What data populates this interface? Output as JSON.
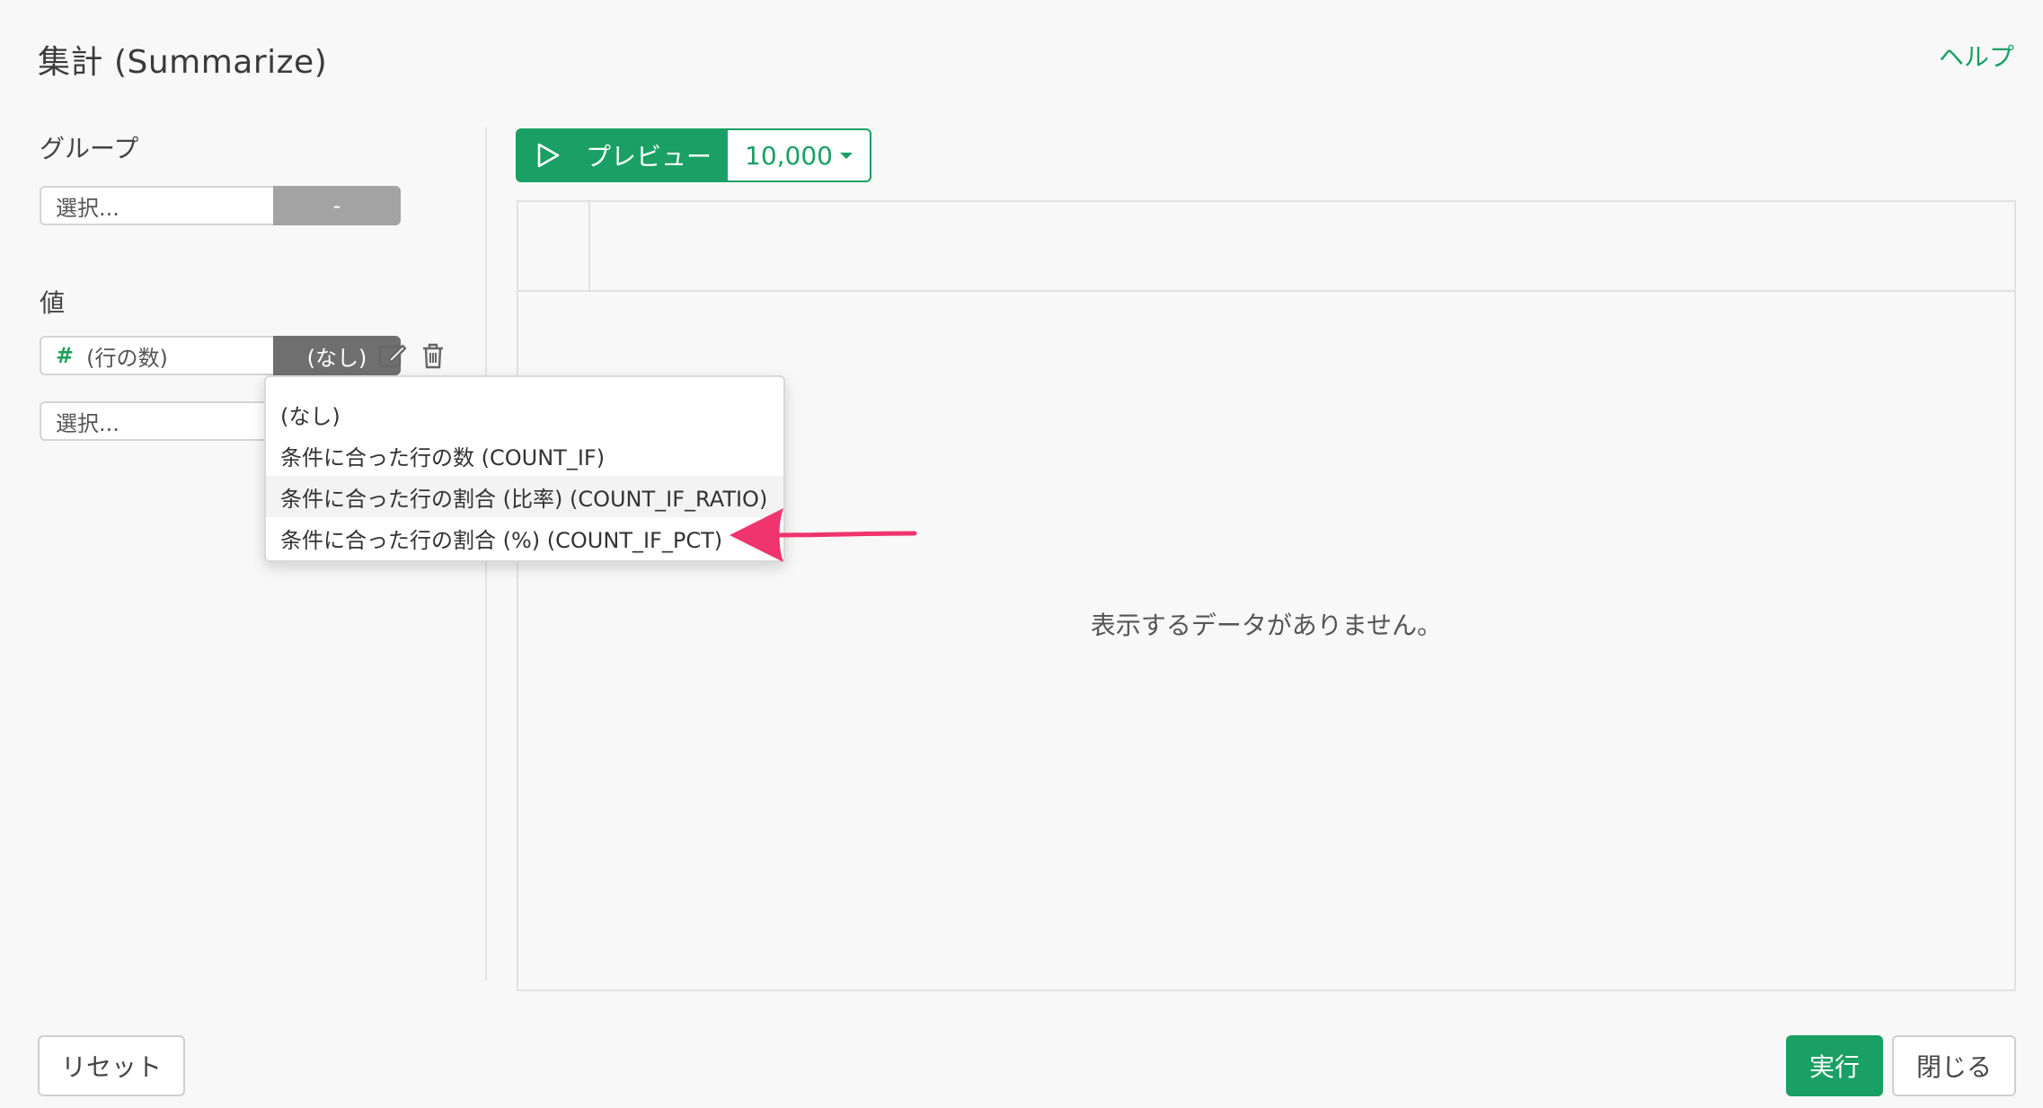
{
  "header": {
    "title": "集計 (Summarize)",
    "help_label": "ヘルプ"
  },
  "group_section": {
    "label": "グループ",
    "select_placeholder": "選択...",
    "side_button_label": "-"
  },
  "value_section": {
    "label": "値",
    "rows": [
      {
        "icon_symbol": "#",
        "column_label": "(行の数)",
        "aggregation_label": "(なし)"
      }
    ],
    "new_select_placeholder": "選択..."
  },
  "aggregation_dropdown": {
    "items": [
      {
        "label": "(なし)"
      },
      {
        "label": "条件に合った行の数 (COUNT_IF)"
      },
      {
        "label": "条件に合った行の割合 (比率) (COUNT_IF_RATIO)"
      },
      {
        "label": "条件に合った行の割合 (%) (COUNT_IF_PCT)"
      }
    ]
  },
  "preview": {
    "button_label": "プレビュー",
    "limit_label": "10,000",
    "empty_message": "表示するデータがありません。"
  },
  "footer": {
    "reset_label": "リセット",
    "run_label": "実行",
    "close_label": "閉じる"
  },
  "colors": {
    "accent": "#1aa064",
    "annotation_arrow": "#f0346e"
  }
}
